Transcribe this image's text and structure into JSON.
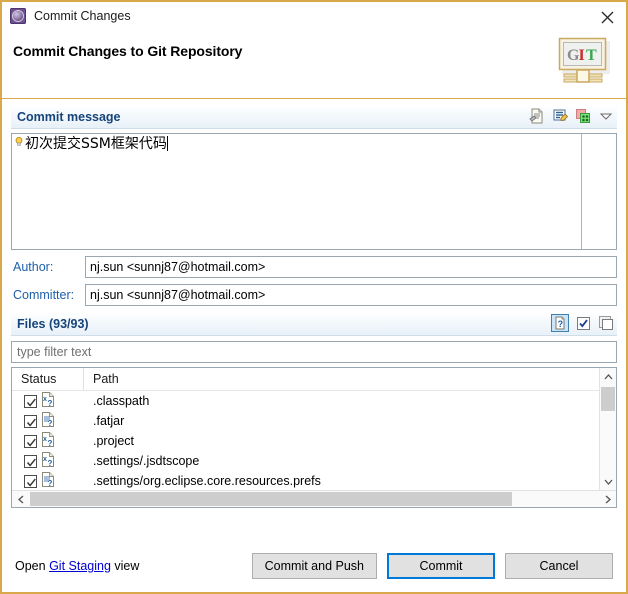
{
  "window": {
    "title": "Commit Changes",
    "icon": "commit-gear-icon",
    "close_label": "✕",
    "border_color": "#d8a84a"
  },
  "header": {
    "title": "Commit Changes to Git Repository",
    "logo": {
      "name": "git-logo",
      "letters": [
        "G",
        "I",
        "T"
      ],
      "letter_colors": [
        "#8b8b8b",
        "#cc2b2b",
        "#3aa655"
      ]
    }
  },
  "commit_message": {
    "section_title": "Commit message",
    "text": "初次提交SSM框架代码",
    "tools": [
      {
        "name": "add-signed-off-by-icon",
        "label": "Add Signed-off-by"
      },
      {
        "name": "add-change-id-icon",
        "label": "Add Change-Id"
      },
      {
        "name": "amend-previous-commit-icon",
        "label": "Amend previous commit"
      },
      {
        "name": "section-menu-chevron-icon",
        "label": "Menu"
      }
    ]
  },
  "author": {
    "label": "Author:",
    "value": "nj.sun <sunnj87@hotmail.com>"
  },
  "committer": {
    "label": "Committer:",
    "value": "nj.sun <sunnj87@hotmail.com>"
  },
  "files": {
    "section_title": "Files",
    "count_text": "(93/93)",
    "tools": [
      {
        "name": "show-untracked-files-icon",
        "label": "Show untracked files",
        "pressed": true
      },
      {
        "name": "select-all-icon",
        "label": "Select all",
        "pressed": false
      },
      {
        "name": "deselect-all-icon",
        "label": "Deselect all",
        "pressed": false
      }
    ],
    "filter_placeholder": "type filter text",
    "filter_value": "",
    "columns": [
      "Status",
      "Path"
    ],
    "rows": [
      {
        "checked": true,
        "icon": "xml-file-untracked-icon",
        "path": ".classpath"
      },
      {
        "checked": true,
        "icon": "text-file-untracked-icon",
        "path": ".fatjar"
      },
      {
        "checked": true,
        "icon": "xml-file-untracked-icon",
        "path": ".project"
      },
      {
        "checked": true,
        "icon": "xml-file-untracked-icon",
        "path": ".settings/.jsdtscope"
      },
      {
        "checked": true,
        "icon": "text-file-untracked-icon",
        "path": ".settings/org.eclipse.core.resources.prefs"
      }
    ]
  },
  "footer": {
    "open_prefix": "Open ",
    "link_text": "Git Staging",
    "open_suffix": " view",
    "buttons": [
      {
        "name": "commit-and-push-button",
        "label": "Commit and Push",
        "primary": false
      },
      {
        "name": "commit-button",
        "label": "Commit",
        "primary": true
      },
      {
        "name": "cancel-button",
        "label": "Cancel",
        "primary": false
      }
    ]
  }
}
